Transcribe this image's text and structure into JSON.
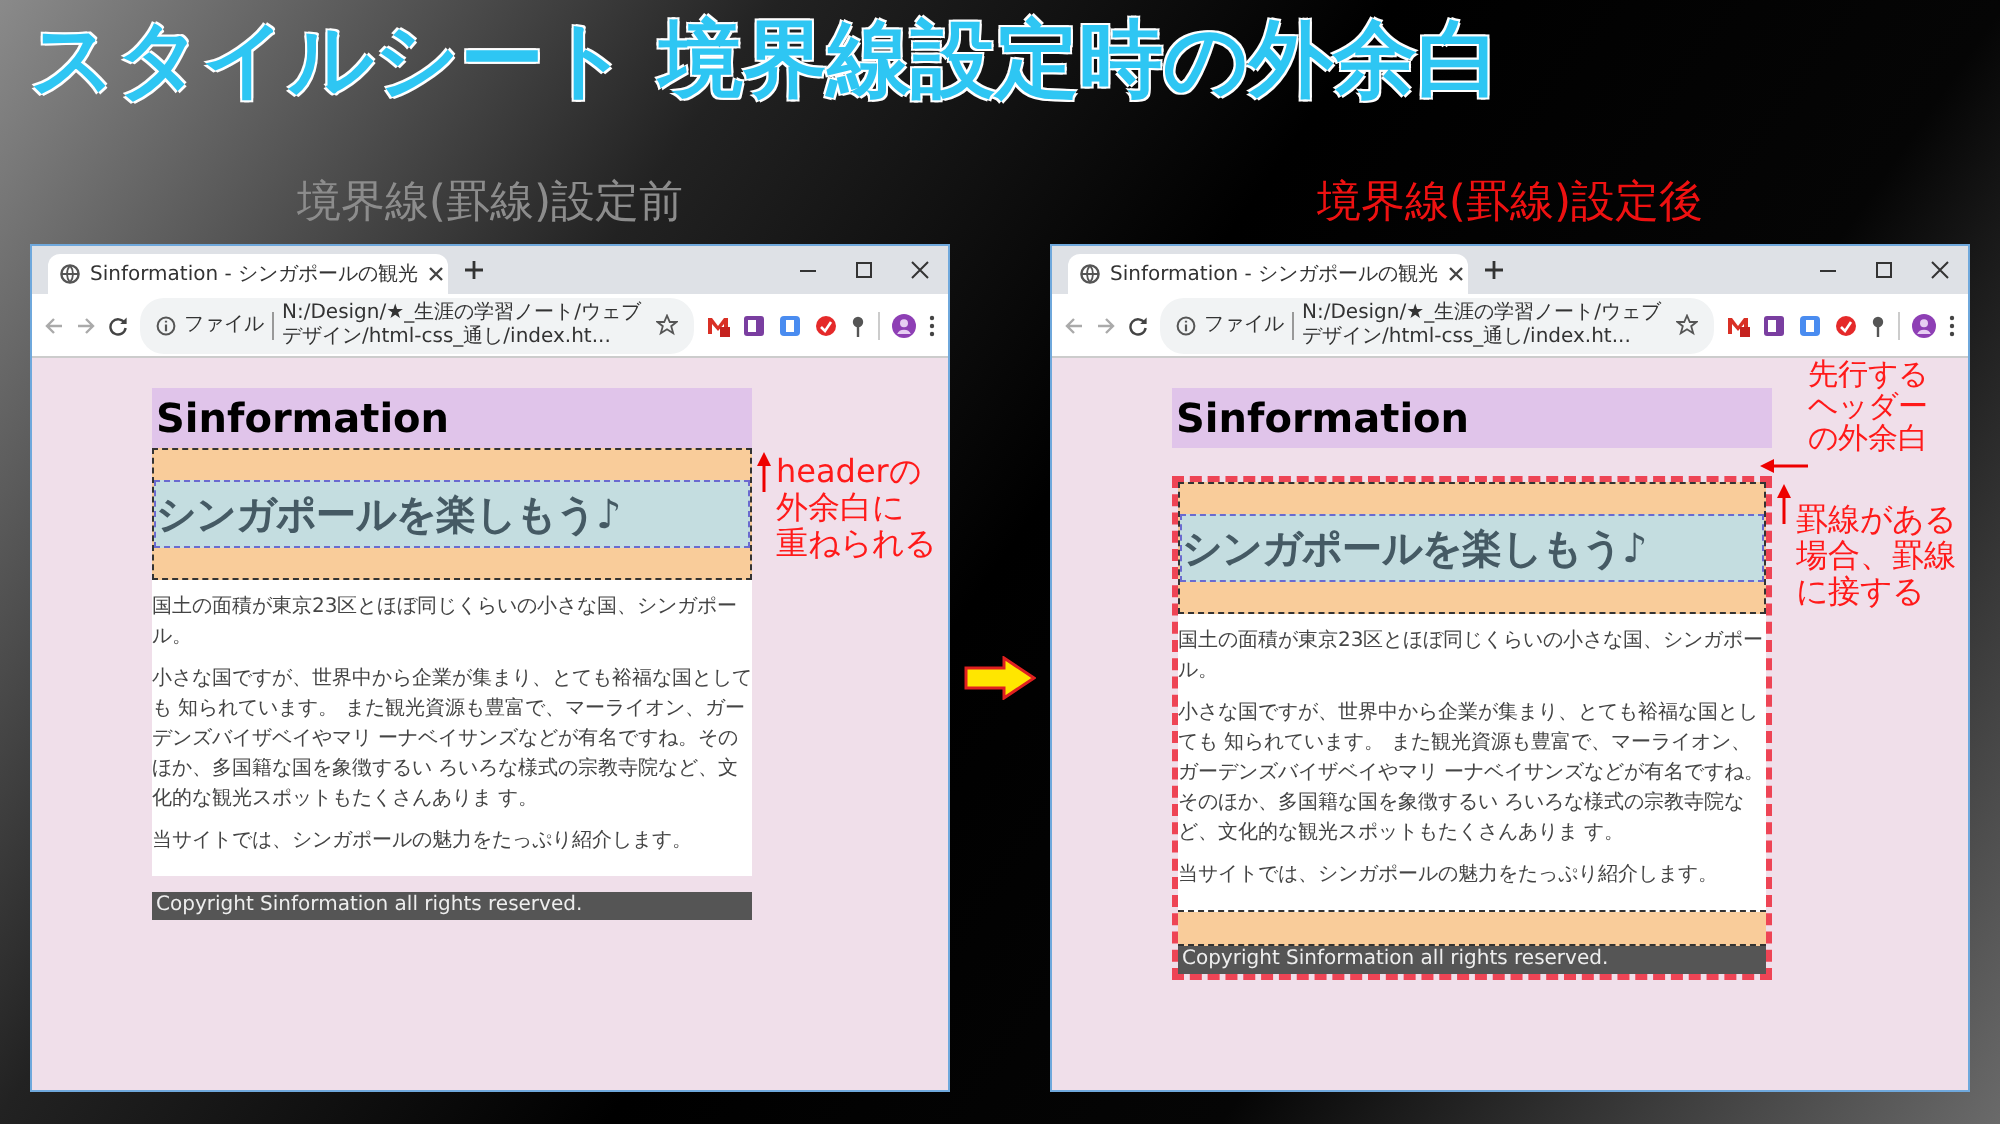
{
  "slide_title": "スタイルシート 境界線設定時の外余白",
  "panels": [
    {
      "kind": "before",
      "caption": "境界線(罫線)設定前",
      "browser": {
        "tab_title": "Sinformation - シンガポールの観光",
        "address_label": "ファイル",
        "url": "N:/Design/★_生涯の学習ノート/ウェブデザイン/html-css_通し/index.ht..."
      },
      "page": {
        "site_title": "Sinformation",
        "heading": "シンガポールを楽しもう♪",
        "paragraphs": [
          "国土の面積が東京23区とほぼ同じくらいの小さな国、シンガポール。",
          "小さな国ですが、世界中から企業が集まり、とても裕福な国としても 知られています。 また観光資源も豊富で、マーライオン、ガーデンズバイザベイやマリ ーナベイサンズなどが有名ですね。そのほか、多国籍な国を象徴するい ろいろな様式の宗教寺院など、文化的な観光スポットもたくさんありま す。",
          "当サイトでは、シンガポールの魅力をたっぷり紹介します。"
        ],
        "footer": "Copyright Sinformation all rights reserved."
      },
      "annotations": [
        {
          "lines": [
            "headerの",
            "外余白に",
            "重ねられる"
          ]
        }
      ]
    },
    {
      "kind": "after",
      "caption": "境界線(罫線)設定後",
      "browser": {
        "tab_title": "Sinformation - シンガポールの観光",
        "address_label": "ファイル",
        "url": "N:/Design/★_生涯の学習ノート/ウェブデザイン/html-css_通し/index.ht..."
      },
      "page": {
        "site_title": "Sinformation",
        "heading": "シンガポールを楽しもう♪",
        "paragraphs": [
          "国土の面積が東京23区とほぼ同じくらいの小さな国、シンガポール。",
          "小さな国ですが、世界中から企業が集まり、とても裕福な国としても 知られています。 また観光資源も豊富で、マーライオン、ガーデンズバイザベイやマリ ーナベイサンズなどが有名ですね。そのほか、多国籍な国を象徴するい ろいろな様式の宗教寺院など、文化的な観光スポットもたくさんありま す。",
          "当サイトでは、シンガポールの魅力をたっぷり紹介します。"
        ],
        "footer": "Copyright Sinformation all rights reserved."
      },
      "annotations": [
        {
          "lines": [
            "先行する",
            "ヘッダー",
            "の外余白"
          ]
        },
        {
          "lines": [
            "罫線がある",
            "場合、罫線",
            "に接する"
          ]
        }
      ]
    }
  ]
}
